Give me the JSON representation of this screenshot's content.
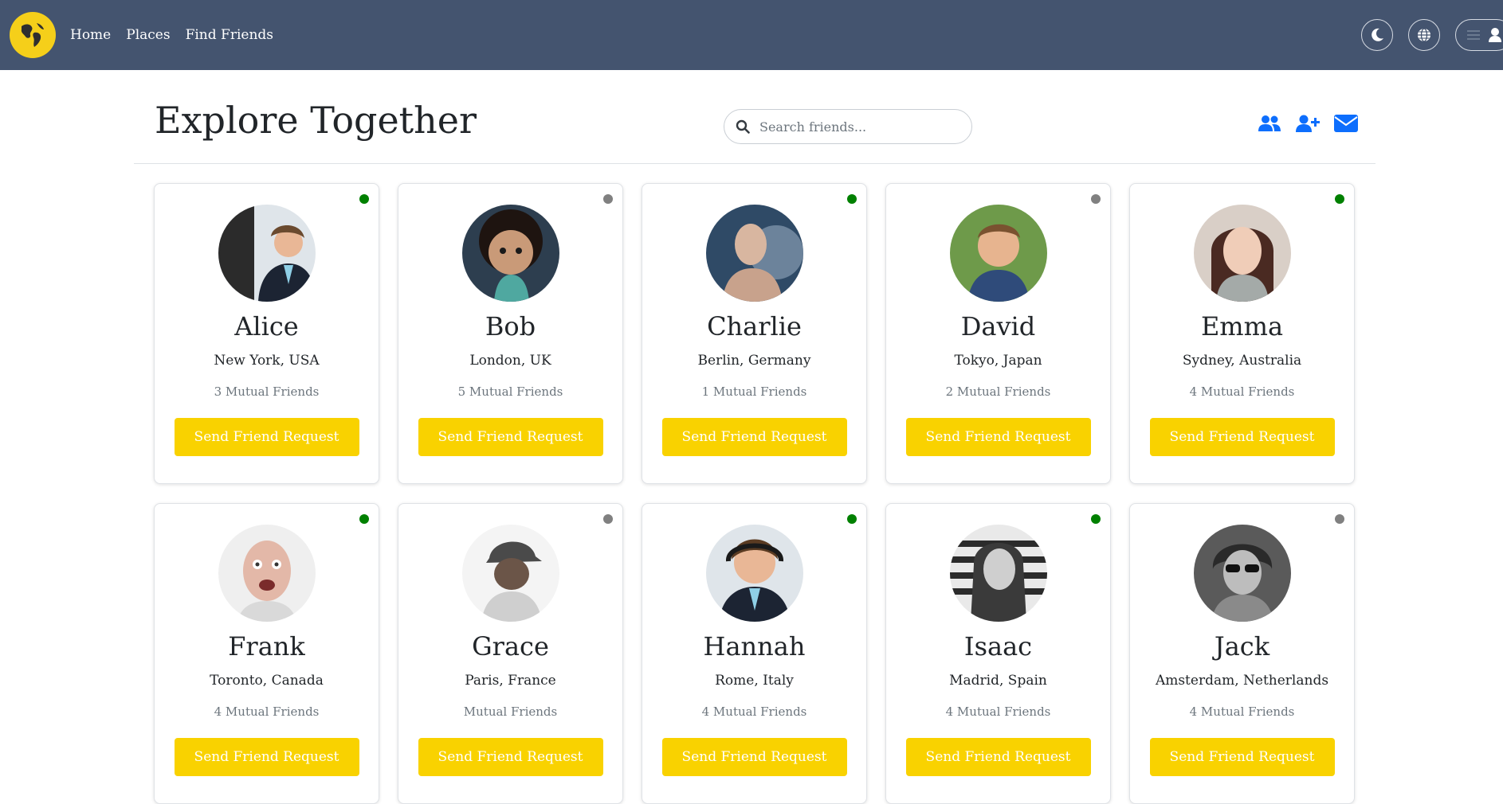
{
  "nav": {
    "links": [
      "Home",
      "Places",
      "Find Friends"
    ],
    "icons": [
      "moon-icon",
      "globe-icon",
      "menu-icon",
      "user-icon"
    ]
  },
  "header": {
    "title": "Explore Together",
    "search_placeholder": "Search friends...",
    "icons": [
      "friends-icon",
      "add-friend-icon",
      "envelope-icon"
    ]
  },
  "colors": {
    "navbar": "#44546f",
    "accent": "#f9d200",
    "online": "#008000",
    "offline": "#808080",
    "link_icon": "#0d6efd"
  },
  "friends": [
    {
      "name": "Alice",
      "location": "New York, USA",
      "mutual": "3 Mutual Friends",
      "status": "online",
      "button": "Send Friend Request"
    },
    {
      "name": "Bob",
      "location": "London, UK",
      "mutual": "5 Mutual Friends",
      "status": "offline",
      "button": "Send Friend Request"
    },
    {
      "name": "Charlie",
      "location": "Berlin, Germany",
      "mutual": "1 Mutual Friends",
      "status": "online",
      "button": "Send Friend Request"
    },
    {
      "name": "David",
      "location": "Tokyo, Japan",
      "mutual": "2 Mutual Friends",
      "status": "offline",
      "button": "Send Friend Request"
    },
    {
      "name": "Emma",
      "location": "Sydney, Australia",
      "mutual": "4 Mutual Friends",
      "status": "online",
      "button": "Send Friend Request"
    },
    {
      "name": "Frank",
      "location": "Toronto, Canada",
      "mutual": "4 Mutual Friends",
      "status": "online",
      "button": "Send Friend Request"
    },
    {
      "name": "Grace",
      "location": "Paris, France",
      "mutual": "Mutual Friends",
      "status": "offline",
      "button": "Send Friend Request"
    },
    {
      "name": "Hannah",
      "location": "Rome, Italy",
      "mutual": "4 Mutual Friends",
      "status": "online",
      "button": "Send Friend Request"
    },
    {
      "name": "Isaac",
      "location": "Madrid, Spain",
      "mutual": "4 Mutual Friends",
      "status": "online",
      "button": "Send Friend Request"
    },
    {
      "name": "Jack",
      "location": "Amsterdam, Netherlands",
      "mutual": "4 Mutual Friends",
      "status": "offline",
      "button": "Send Friend Request"
    }
  ]
}
